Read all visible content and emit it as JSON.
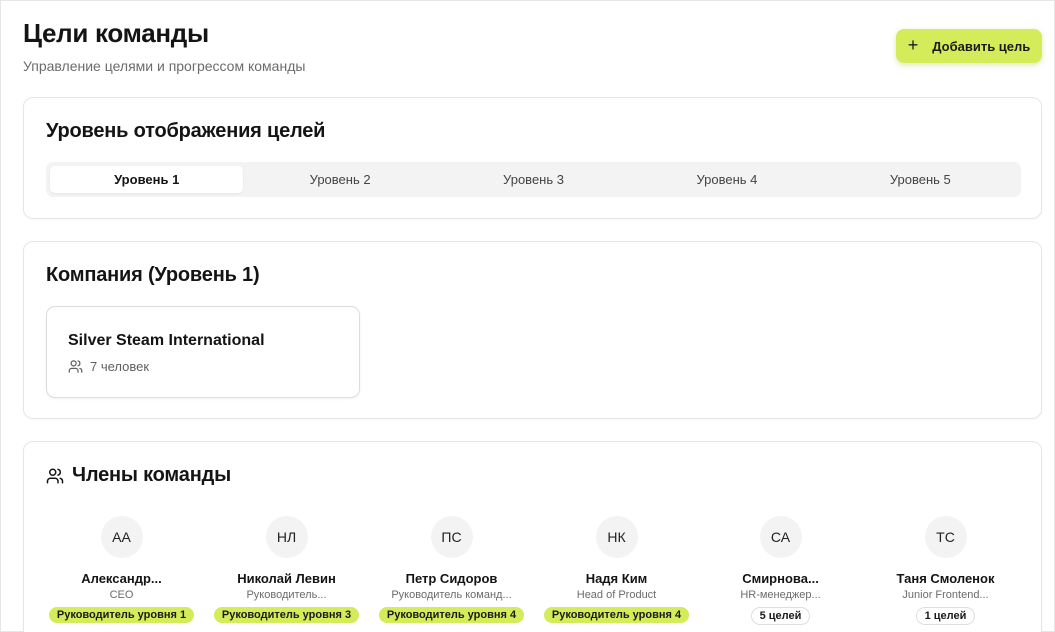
{
  "header": {
    "title": "Цели команды",
    "subtitle": "Управление целями и прогрессом команды",
    "add_button_label": "Добавить цель",
    "add_button_icon": "plus-icon"
  },
  "levels": {
    "title": "Уровень отображения целей",
    "tabs": [
      "Уровень 1",
      "Уровень 2",
      "Уровень 3",
      "Уровень 4",
      "Уровень 5"
    ],
    "active_index": 0
  },
  "company": {
    "title": "Компания (Уровень 1)",
    "name": "Silver Steam International",
    "people": "7 человек",
    "people_icon": "users-icon"
  },
  "members": {
    "title": "Члены команды",
    "icon": "users-icon",
    "items": [
      {
        "initials": "АА",
        "name": "Александр...",
        "role": "CEO",
        "level": "Руководитель уровня 1"
      },
      {
        "initials": "НЛ",
        "name": "Николай Левин",
        "role": "Руководитель...",
        "level": "Руководитель уровня 3"
      },
      {
        "initials": "ПС",
        "name": "Петр Сидоров",
        "role": "Руководитель команд...",
        "level": "Руководитель уровня 4"
      },
      {
        "initials": "НК",
        "name": "Надя Ким",
        "role": "Head of Product",
        "level": "Руководитель уровня 4"
      },
      {
        "initials": "СА",
        "name": "Смирнова...",
        "role": "HR-менеджер...",
        "goals": "5 целей"
      },
      {
        "initials": "ТС",
        "name": "Таня Смоленок",
        "role": "Junior Frontend...",
        "goals": "1 целей"
      }
    ]
  },
  "colors": {
    "accent": "#d4ec5a",
    "text": "#141414",
    "muted": "#6b6b6b",
    "border": "#e6e6e6"
  }
}
